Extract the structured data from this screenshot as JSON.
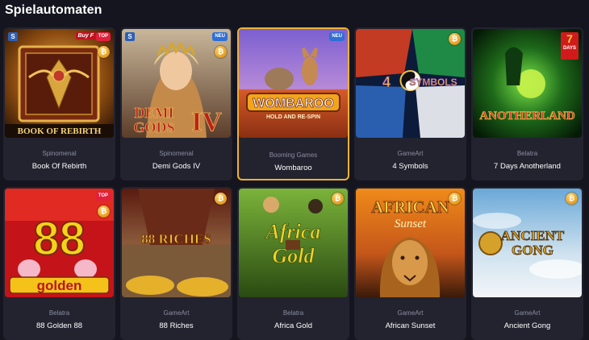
{
  "section": {
    "title": "Spielautomaten"
  },
  "badges": {
    "top": "TOP",
    "new": "NEU",
    "coin_symbol": "₿",
    "s_symbol": "S"
  },
  "extras": {
    "buy_label": "Buy F",
    "days_number": "7",
    "days_label": "DAYS"
  },
  "games": [
    {
      "provider": "Spinomenal",
      "name": "Book Of Rebirth",
      "art_title": "BOOK OF REBIRTH"
    },
    {
      "provider": "Spinomenal",
      "name": "Demi Gods IV",
      "art_title": "DEMI GODS IV"
    },
    {
      "provider": "Booming Games",
      "name": "Wombaroo",
      "art_title": "WOMBAROO",
      "art_subtitle": "HOLD AND RE-SPIN"
    },
    {
      "provider": "GameArt",
      "name": "4 Symbols",
      "art_title": "4 SYMBOLS"
    },
    {
      "provider": "Belatra",
      "name": "7 Days Anotherland",
      "art_title": "ANOTHERLAND"
    },
    {
      "provider": "Belatra",
      "name": "88 Golden 88",
      "art_title": "88",
      "art_subtitle": "golden"
    },
    {
      "provider": "GameArt",
      "name": "88 Riches",
      "art_title": "88 RICHES"
    },
    {
      "provider": "Belatra",
      "name": "Africa Gold",
      "art_title": "Africa Gold"
    },
    {
      "provider": "GameArt",
      "name": "African Sunset",
      "art_title": "AFRICAN",
      "art_subtitle": "Sunset"
    },
    {
      "provider": "GameArt",
      "name": "Ancient Gong",
      "art_title": "ANCIENT GONG"
    }
  ]
}
